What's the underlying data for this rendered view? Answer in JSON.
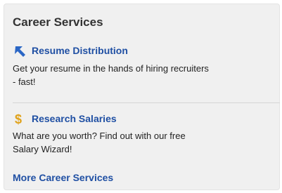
{
  "panel": {
    "title": "Career Services",
    "items": [
      {
        "icon": "arrow-upleft-icon",
        "link": "Resume Distribution",
        "description_lines": [
          "Get your resume in the hands of hiring recruiters",
          "- fast!"
        ]
      },
      {
        "icon": "dollar-icon",
        "link": "Research Salaries",
        "description_lines": [
          "What are you worth? Find out with our free",
          "Salary Wizard!"
        ]
      }
    ],
    "more_link": "More Career Services"
  },
  "colors": {
    "panel_bg": "#f0f0f0",
    "link": "#1f4fa3",
    "title": "#333333",
    "icon_arrow": "#2a66c5",
    "icon_dollar": "#e0a21b"
  }
}
